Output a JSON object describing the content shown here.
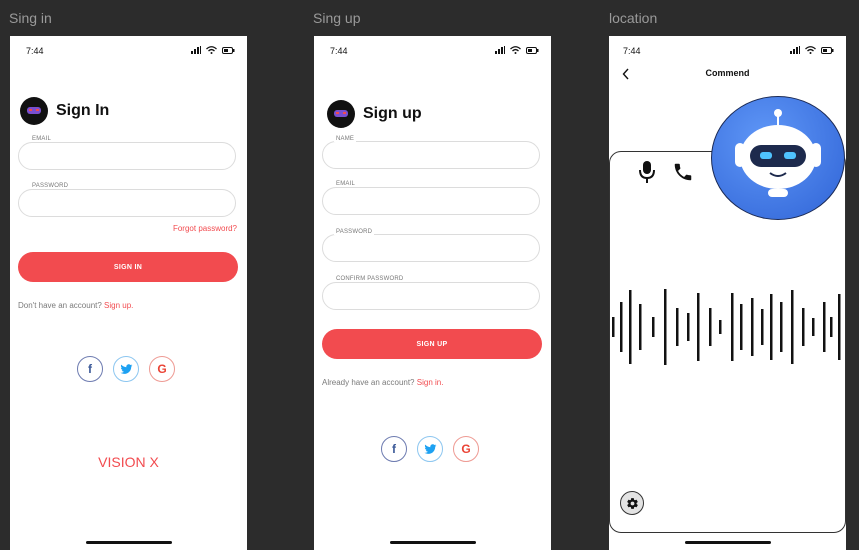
{
  "frames": {
    "signin_label": "Sing in",
    "signup_label": "Sing up",
    "location_label": "location"
  },
  "status": {
    "time": "7:44"
  },
  "signin": {
    "title": "Sign In",
    "email_label": "EMAIL",
    "password_label": "PASSWORD",
    "forgot": "Forgot  password?",
    "button": "SIGN IN",
    "no_account": "Don't have an account?",
    "signup_link": "Sign up.",
    "brand": "VISION X"
  },
  "signup": {
    "title": "Sign up",
    "name_label": "NAME",
    "email_label": "EMAIL",
    "password_label": "PASSWORD",
    "confirm_label": "CONFIRM PASSWORD",
    "button": "SIGN UP",
    "have_account": "Already have an account?",
    "signin_link": "Sign in."
  },
  "command": {
    "title": "Commend"
  },
  "colors": {
    "accent": "#f24b4f",
    "facebook": "#3b5998",
    "twitter": "#1da1f2",
    "google": "#ea4335",
    "robot_bg": "#3a7bf0"
  },
  "icons": [
    "facebook-icon",
    "twitter-icon",
    "google-icon",
    "mic-icon",
    "phone-icon",
    "settings-icon",
    "back-icon"
  ]
}
